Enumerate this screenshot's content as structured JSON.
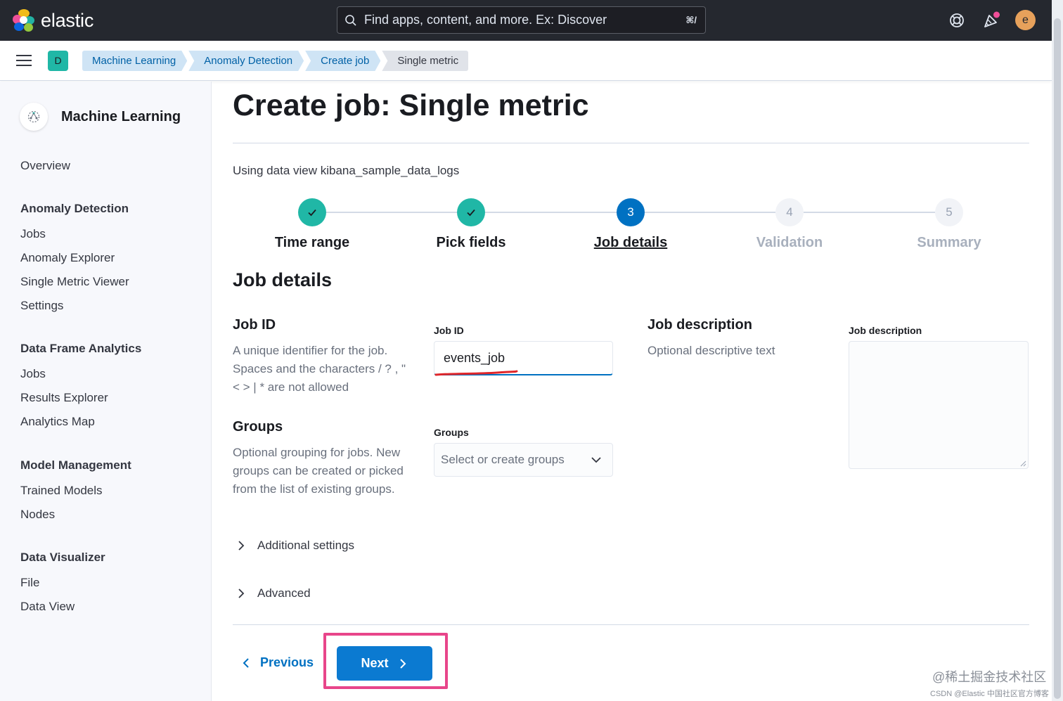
{
  "header": {
    "brand": "elastic",
    "search_placeholder": "Find apps, content, and more. Ex: Discover",
    "search_shortcut": "⌘/",
    "avatar_initial": "e"
  },
  "breadcrumbs": {
    "space_initial": "D",
    "items": [
      "Machine Learning",
      "Anomaly Detection",
      "Create job",
      "Single metric"
    ]
  },
  "sidebar": {
    "title": "Machine Learning",
    "overview": "Overview",
    "anomaly_detection": {
      "heading": "Anomaly Detection",
      "items": [
        "Jobs",
        "Anomaly Explorer",
        "Single Metric Viewer",
        "Settings"
      ]
    },
    "data_frame_analytics": {
      "heading": "Data Frame Analytics",
      "items": [
        "Jobs",
        "Results Explorer",
        "Analytics Map"
      ]
    },
    "model_management": {
      "heading": "Model Management",
      "items": [
        "Trained Models",
        "Nodes"
      ]
    },
    "data_visualizer": {
      "heading": "Data Visualizer",
      "items": [
        "File",
        "Data View"
      ]
    }
  },
  "main": {
    "title": "Create job: Single metric",
    "subtitle": "Using data view kibana_sample_data_logs",
    "steps": [
      {
        "label": "Time range",
        "status": "complete",
        "number": ""
      },
      {
        "label": "Pick fields",
        "status": "complete",
        "number": ""
      },
      {
        "label": "Job details",
        "status": "current",
        "number": "3"
      },
      {
        "label": "Validation",
        "status": "incomplete",
        "number": "4"
      },
      {
        "label": "Summary",
        "status": "incomplete",
        "number": "5"
      }
    ],
    "section_title": "Job details",
    "job_id": {
      "title": "Job ID",
      "description": "A unique identifier for the job. Spaces and the characters / ? , \" < > | * are not allowed",
      "label": "Job ID",
      "value": "events_job"
    },
    "job_description": {
      "title": "Job description",
      "description": "Optional descriptive text",
      "label": "Job description",
      "value": ""
    },
    "groups": {
      "title": "Groups",
      "description": "Optional grouping for jobs. New groups can be created or picked from the list of existing groups.",
      "label": "Groups",
      "placeholder": "Select or create groups"
    },
    "accordions": [
      "Additional settings",
      "Advanced"
    ],
    "previous_label": "Previous",
    "next_label": "Next"
  },
  "watermark": "@稀土掘金技术社区",
  "watermark_small": "CSDN @Elastic 中国社区官方博客",
  "colors": {
    "header_bg": "#25282f",
    "primary": "#0071c2",
    "success": "#20b7a6",
    "highlight": "#e8458a",
    "annotation": "#e0262a"
  }
}
